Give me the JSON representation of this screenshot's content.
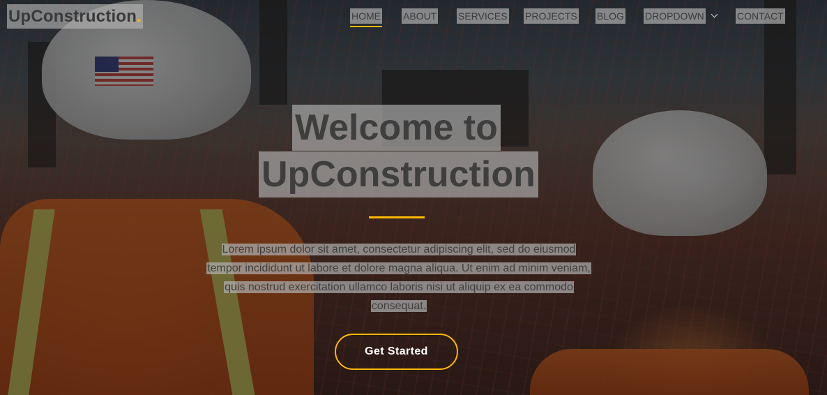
{
  "brand": {
    "name": "UpConstruction",
    "dot": "."
  },
  "nav": {
    "items": [
      {
        "label": "HOME",
        "active": true
      },
      {
        "label": "ABOUT",
        "active": false
      },
      {
        "label": "SERVICES",
        "active": false
      },
      {
        "label": "PROJECTS",
        "active": false
      },
      {
        "label": "BLOG",
        "active": false
      },
      {
        "label": "DROPDOWN",
        "active": false,
        "icon": "chevron-down-icon"
      },
      {
        "label": "CONTACT",
        "active": false
      }
    ]
  },
  "hero": {
    "title_line1": "Welcome to",
    "title_line2": "UpConstruction",
    "description": "Lorem ipsum dolor sit amet, consectetur adipiscing elit, sed do eiusmod tempor incididunt ut labore et dolore magna aliqua. Ut enim ad minim veniam, quis nostrud exercitation ullamco laboris nisi ut aliquip ex ea commodo consequat.",
    "cta_label": "Get Started"
  },
  "colors": {
    "accent": "#feb900",
    "overlay": "rgba(0,0,0,0.45)"
  }
}
